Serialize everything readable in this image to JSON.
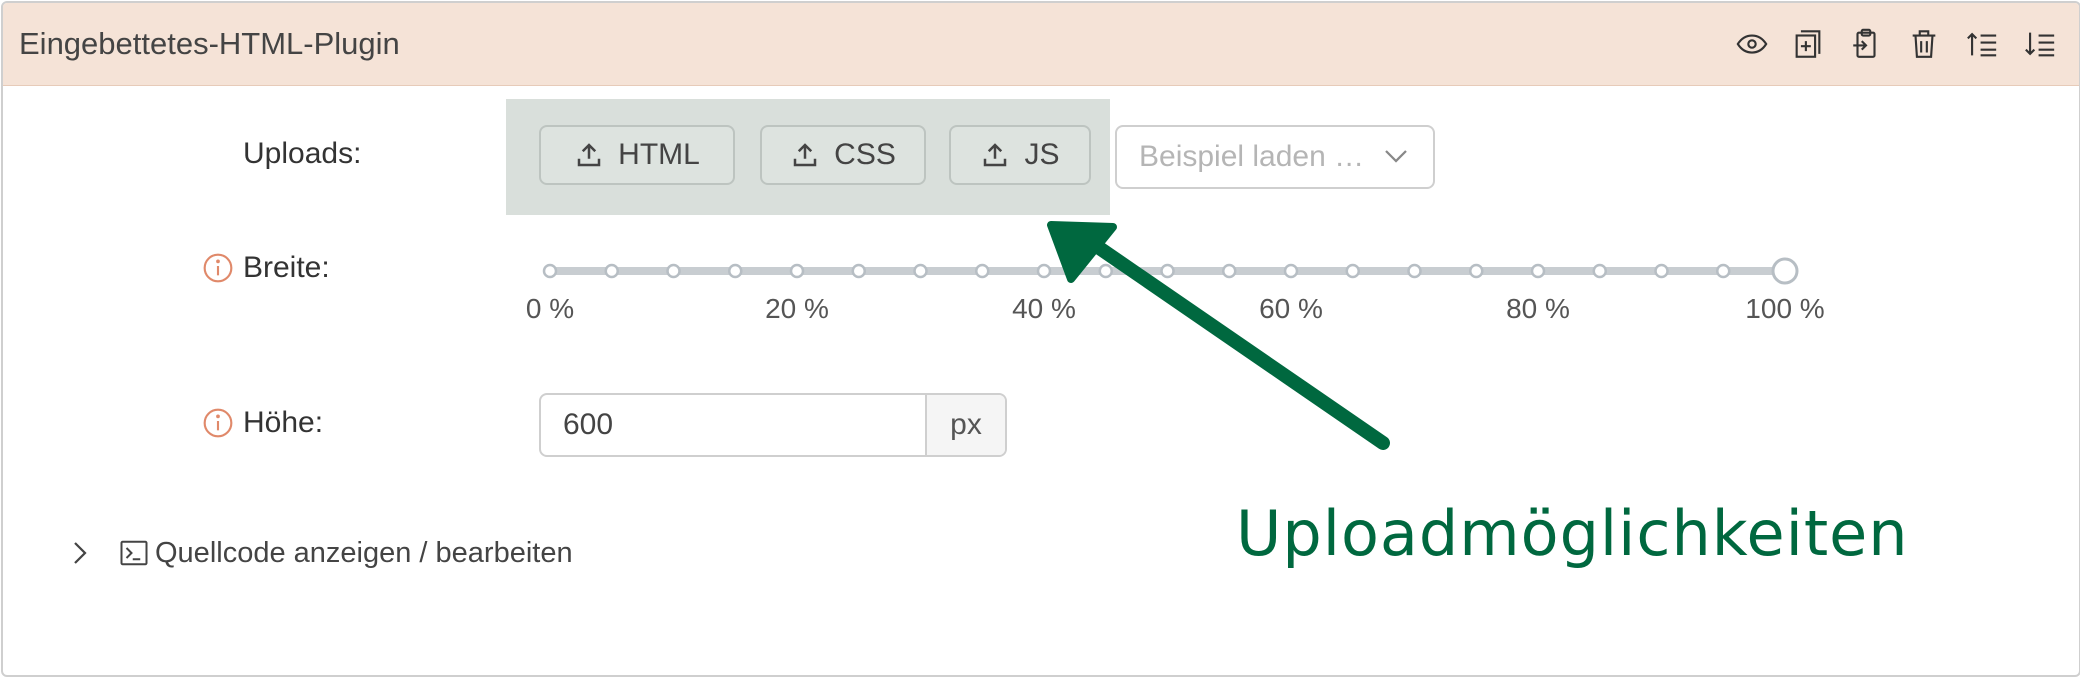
{
  "header": {
    "title": "Eingebettetes-HTML-Plugin",
    "background": "#f5e3d7"
  },
  "uploads": {
    "label": "Uploads",
    "colon": ":",
    "buttons": [
      {
        "label": "HTML",
        "icon": "upload-icon"
      },
      {
        "label": "CSS",
        "icon": "upload-icon"
      },
      {
        "label": "JS",
        "icon": "upload-icon"
      }
    ],
    "example_select": {
      "placeholder": "Beispiel laden …"
    }
  },
  "width": {
    "label": "Breite",
    "colon": ":",
    "value_percent": 100,
    "tick_labels": [
      "0 %",
      "20 %",
      "40 %",
      "60 %",
      "80 %",
      "100 %"
    ]
  },
  "height": {
    "label": "Höhe",
    "colon": ":",
    "value": "600",
    "unit": "px"
  },
  "source_toggle": {
    "label": "Quellcode anzeigen / bearbeiten"
  },
  "annotation": {
    "text": "Uploadmöglichkeiten",
    "color": "#00683f"
  },
  "colors": {
    "info_icon": "#e0896a",
    "upload_area": "#d9dfdb",
    "accent_green": "#00683f"
  }
}
